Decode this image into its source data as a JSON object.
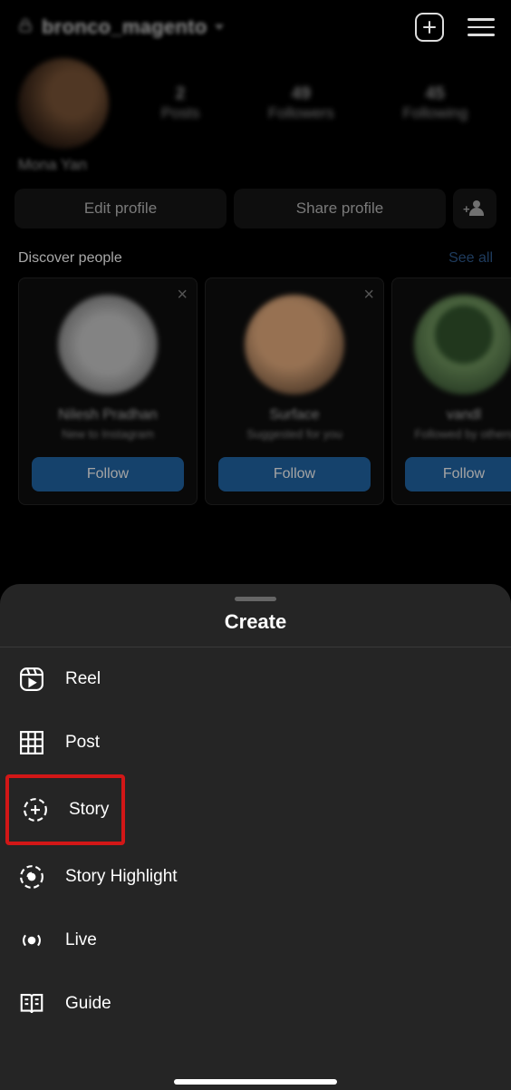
{
  "header": {
    "username": "bronco_magento",
    "add_label": "+",
    "menu_label": "menu"
  },
  "profile": {
    "display_name": "Mona Yan",
    "stats": {
      "posts_num": "2",
      "posts_label": "Posts",
      "followers_num": "49",
      "followers_label": "Followers",
      "following_num": "45",
      "following_label": "Following"
    }
  },
  "actions": {
    "edit": "Edit profile",
    "share": "Share profile"
  },
  "discover": {
    "title": "Discover people",
    "see_all": "See all",
    "cards": [
      {
        "name": "Nilesh Pradhan",
        "sub": "New to Instagram",
        "btn": "Follow"
      },
      {
        "name": "Surface",
        "sub": "Suggested for you",
        "btn": "Follow"
      },
      {
        "name": "vandl",
        "sub": "Followed by others",
        "btn": "Follow"
      }
    ]
  },
  "sheet": {
    "title": "Create",
    "items": [
      {
        "key": "reel",
        "label": "Reel"
      },
      {
        "key": "post",
        "label": "Post"
      },
      {
        "key": "story",
        "label": "Story"
      },
      {
        "key": "story_highlight",
        "label": "Story Highlight"
      },
      {
        "key": "live",
        "label": "Live"
      },
      {
        "key": "guide",
        "label": "Guide"
      }
    ]
  }
}
